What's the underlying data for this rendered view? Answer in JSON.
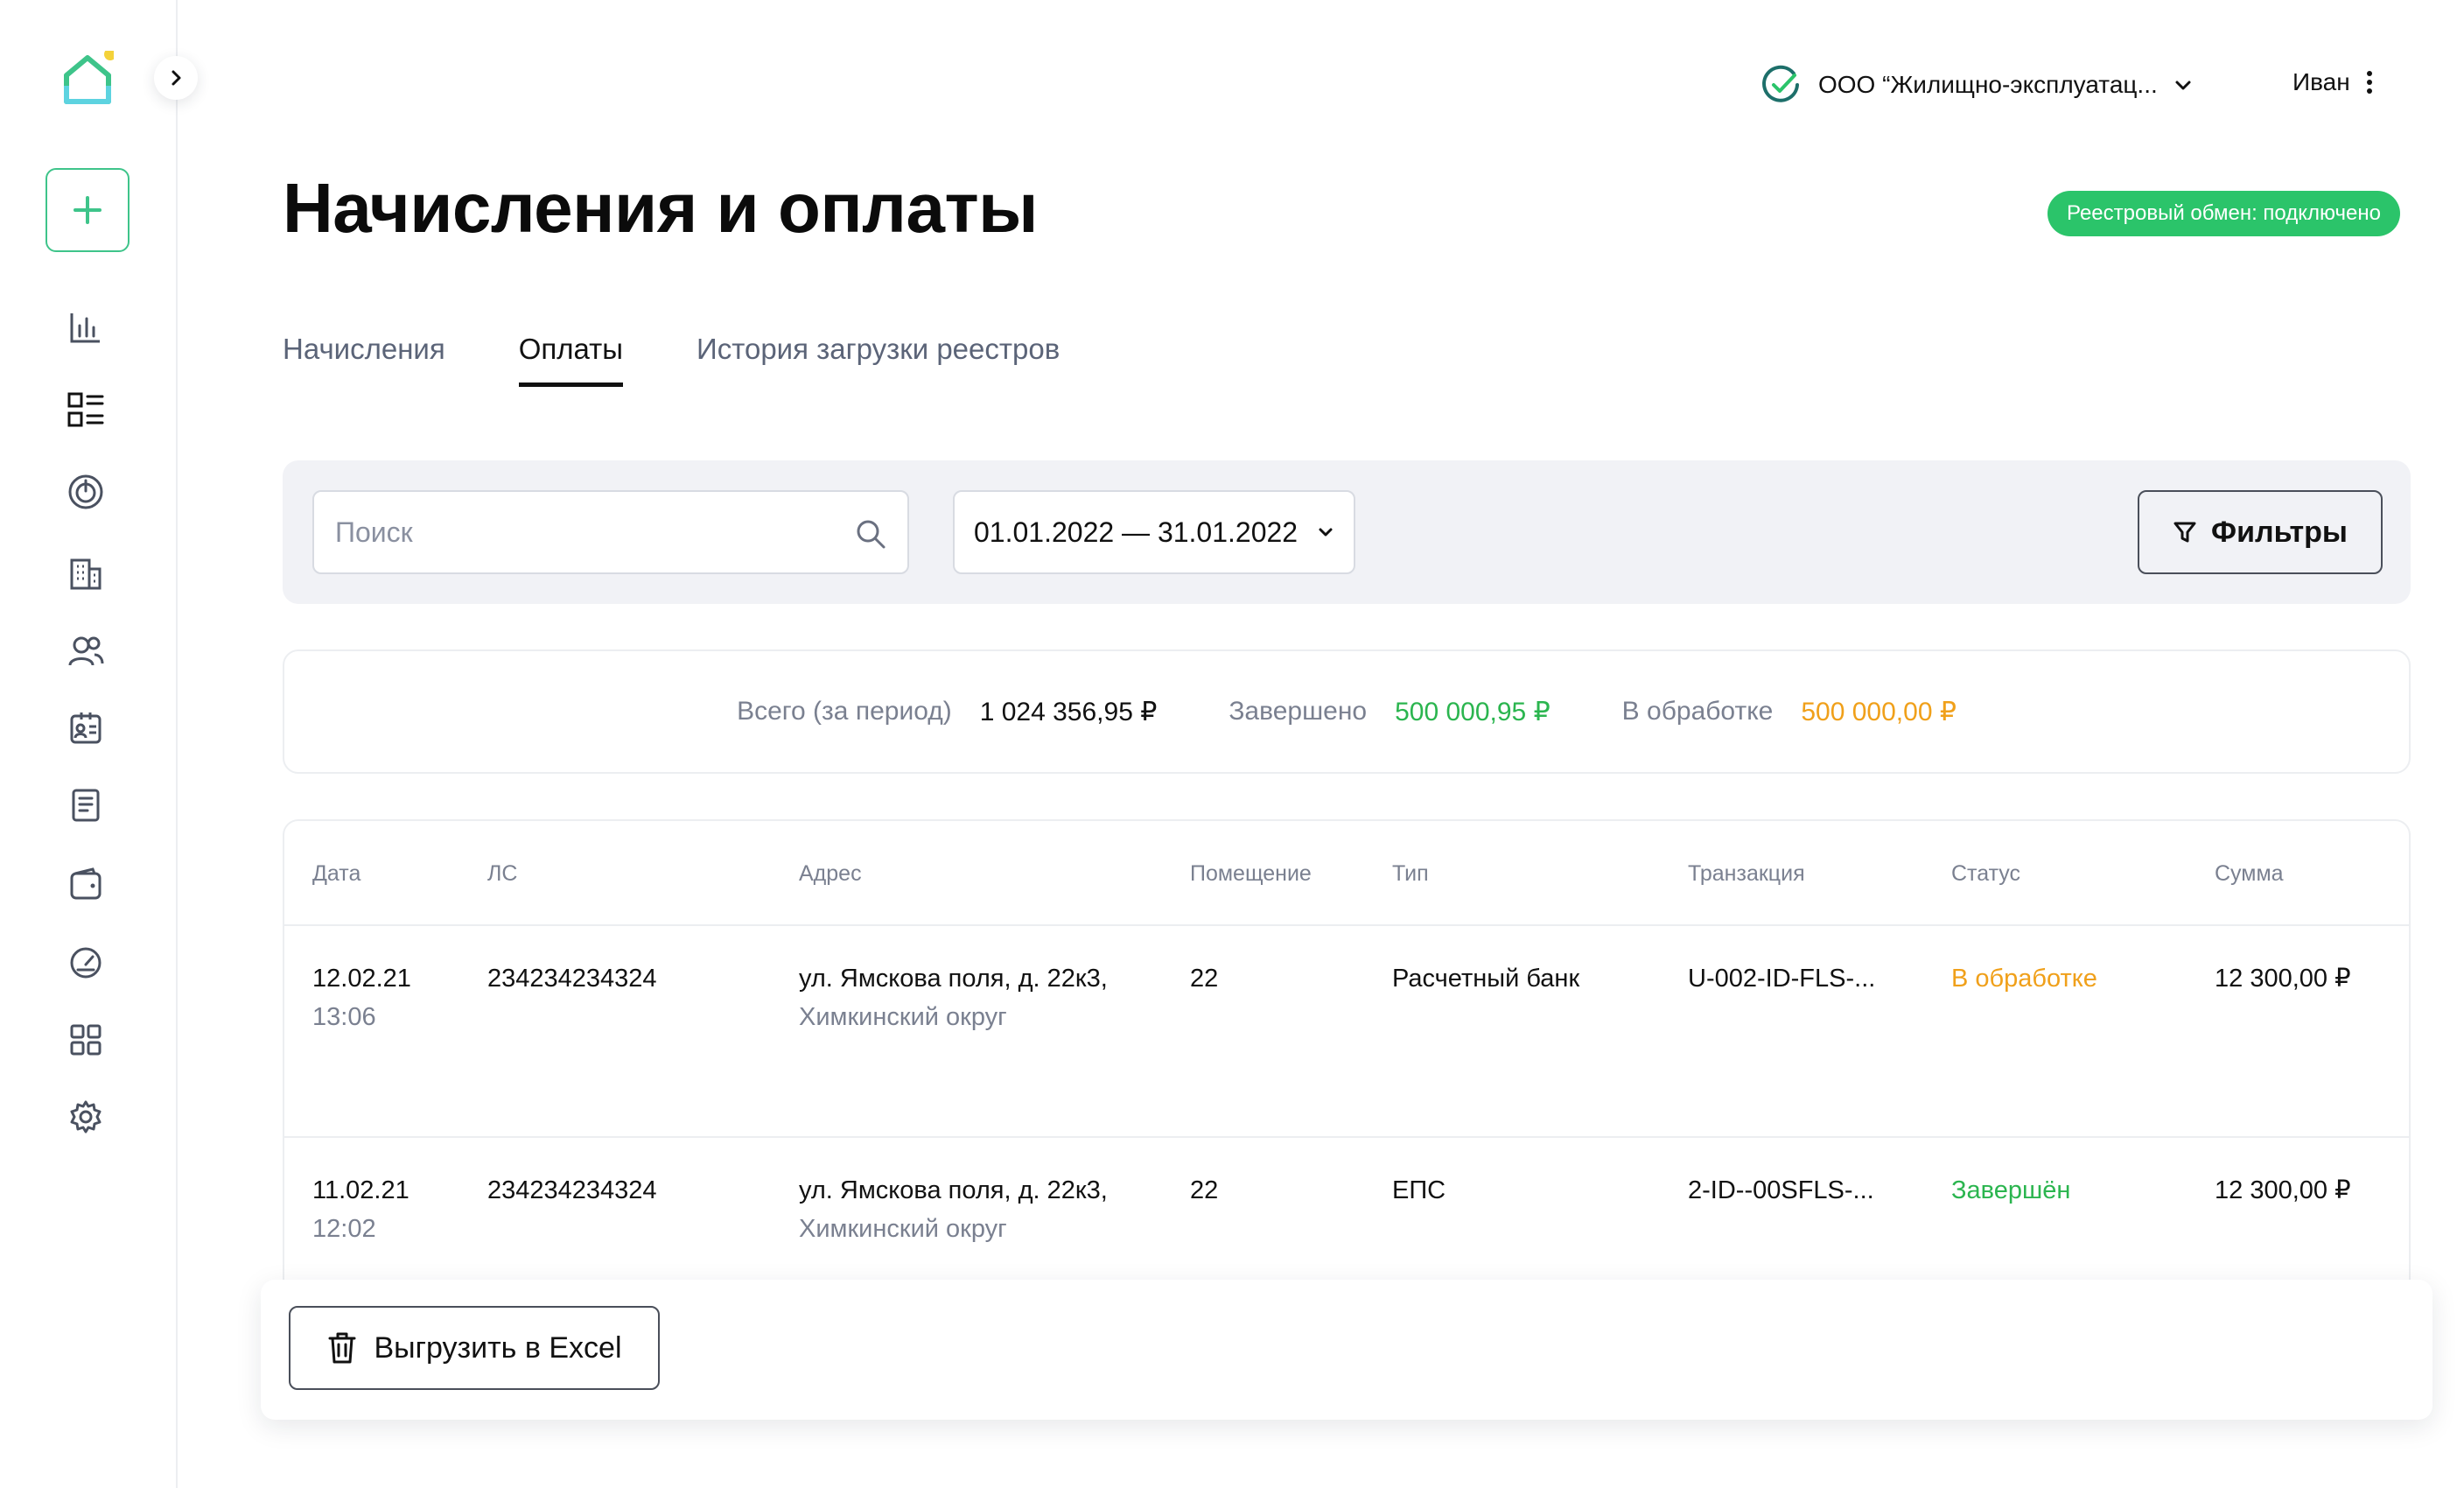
{
  "sidebar": {
    "logo_icon": "house-icon",
    "accent_color": "#3ec48a",
    "dot_color": "#f4d23a",
    "items": [
      {
        "icon": "bar-chart-icon"
      },
      {
        "icon": "list-icon"
      },
      {
        "icon": "power-icon"
      },
      {
        "icon": "building-icon"
      },
      {
        "icon": "users-icon"
      },
      {
        "icon": "id-card-icon"
      },
      {
        "icon": "document-icon"
      },
      {
        "icon": "wallet-icon"
      },
      {
        "icon": "gauge-icon"
      },
      {
        "icon": "grid-icon"
      },
      {
        "icon": "gear-icon"
      }
    ]
  },
  "header": {
    "org_name": "ООО “Жилищно-эксплуатац...",
    "user_name": "Иван"
  },
  "page": {
    "title": "Начисления и оплаты",
    "exchange_status": "Реестровый обмен: подключено"
  },
  "tabs": [
    {
      "label": "Начисления",
      "active": false
    },
    {
      "label": "Оплаты",
      "active": true
    },
    {
      "label": "История загрузки реестров",
      "active": false
    }
  ],
  "filters": {
    "search_placeholder": "Поиск",
    "date_range": "01.01.2022 — 31.01.2022",
    "filters_label": "Фильтры"
  },
  "summary": {
    "total_label": "Всего (за период)",
    "total_value": "1 024 356,95 ₽",
    "done_label": "Завершено",
    "done_value": "500 000,95 ₽",
    "processing_label": "В обработке",
    "processing_value": "500 000,00 ₽"
  },
  "table": {
    "columns": [
      "Дата",
      "ЛС",
      "Адрес",
      "Помещение",
      "Тип",
      "Транзакция",
      "Статус",
      "Сумма"
    ],
    "rows": [
      {
        "date": "12.02.21",
        "time": "13:06",
        "account": "234234234324",
        "address": "ул. Ямскова поля, д. 22к3,",
        "district": "Химкинский округ",
        "room": "22",
        "type": "Расчетный банк",
        "transaction": "U-002-ID-FLS-...",
        "status": "В обработке",
        "amount": "12 300,00 ₽"
      },
      {
        "date": "11.02.21",
        "time": "12:02",
        "account": "234234234324",
        "address": "ул. Ямскова поля, д. 22к3,",
        "district": "Химкинский округ",
        "room": "22",
        "type": "ЕПС",
        "transaction": "2-ID--00SFLS-...",
        "status": "Завершён",
        "amount": "12 300,00 ₽"
      }
    ]
  },
  "actions": {
    "export_label": "Выгрузить в Excel"
  },
  "colors": {
    "badge": "#2bc46a",
    "done": "#2bb54f",
    "processing": "#f0a01a"
  }
}
